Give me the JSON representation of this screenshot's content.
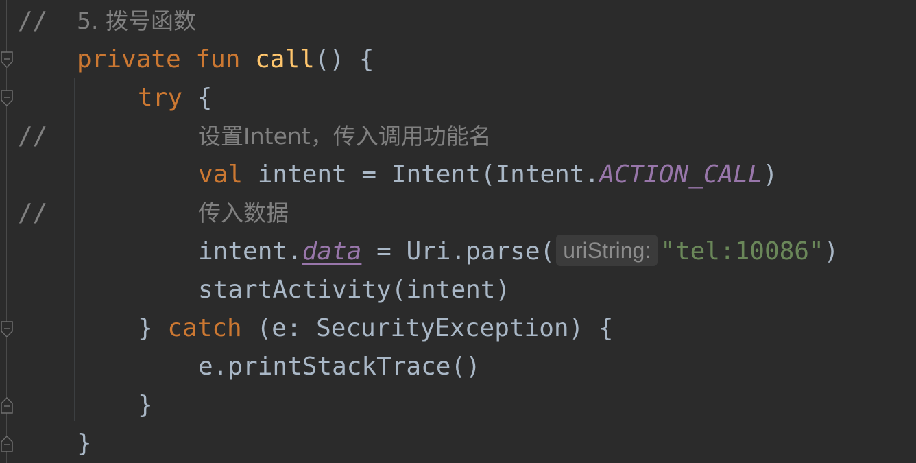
{
  "code": {
    "line1": {
      "marker": "//",
      "text": "5. 拨号函数"
    },
    "line2": {
      "kw": "private fun",
      "name": "call",
      "rest": "() {"
    },
    "line3": {
      "kw": "try",
      "rest": " {"
    },
    "line4": {
      "marker": "//",
      "text": "设置Intent，传入调用功能名"
    },
    "line5": {
      "kw": "val",
      "mid": " intent = Intent(Intent.",
      "constant": "ACTION_CALL",
      "end": ")"
    },
    "line6": {
      "marker": "//",
      "text": "传入数据"
    },
    "line7": {
      "pre": "intent.",
      "prop": "data",
      "mid": " = Uri.parse(",
      "hint": "uriString:",
      "str": "\"tel:10086\"",
      "end": ")"
    },
    "line8": {
      "text": "startActivity(intent)"
    },
    "line9": {
      "brace": "} ",
      "kw": "catch",
      "rest": " (e: SecurityException) {"
    },
    "line10": {
      "text": "e.printStackTrace()"
    },
    "line11": {
      "text": "}"
    },
    "line12": {
      "text": "}"
    }
  },
  "colors": {
    "background": "#2b2b2b",
    "comment": "#808080",
    "keyword": "#cc7832",
    "function": "#ffc66d",
    "plain": "#a9b7c6",
    "constant": "#9876aa",
    "string": "#6a8759"
  }
}
